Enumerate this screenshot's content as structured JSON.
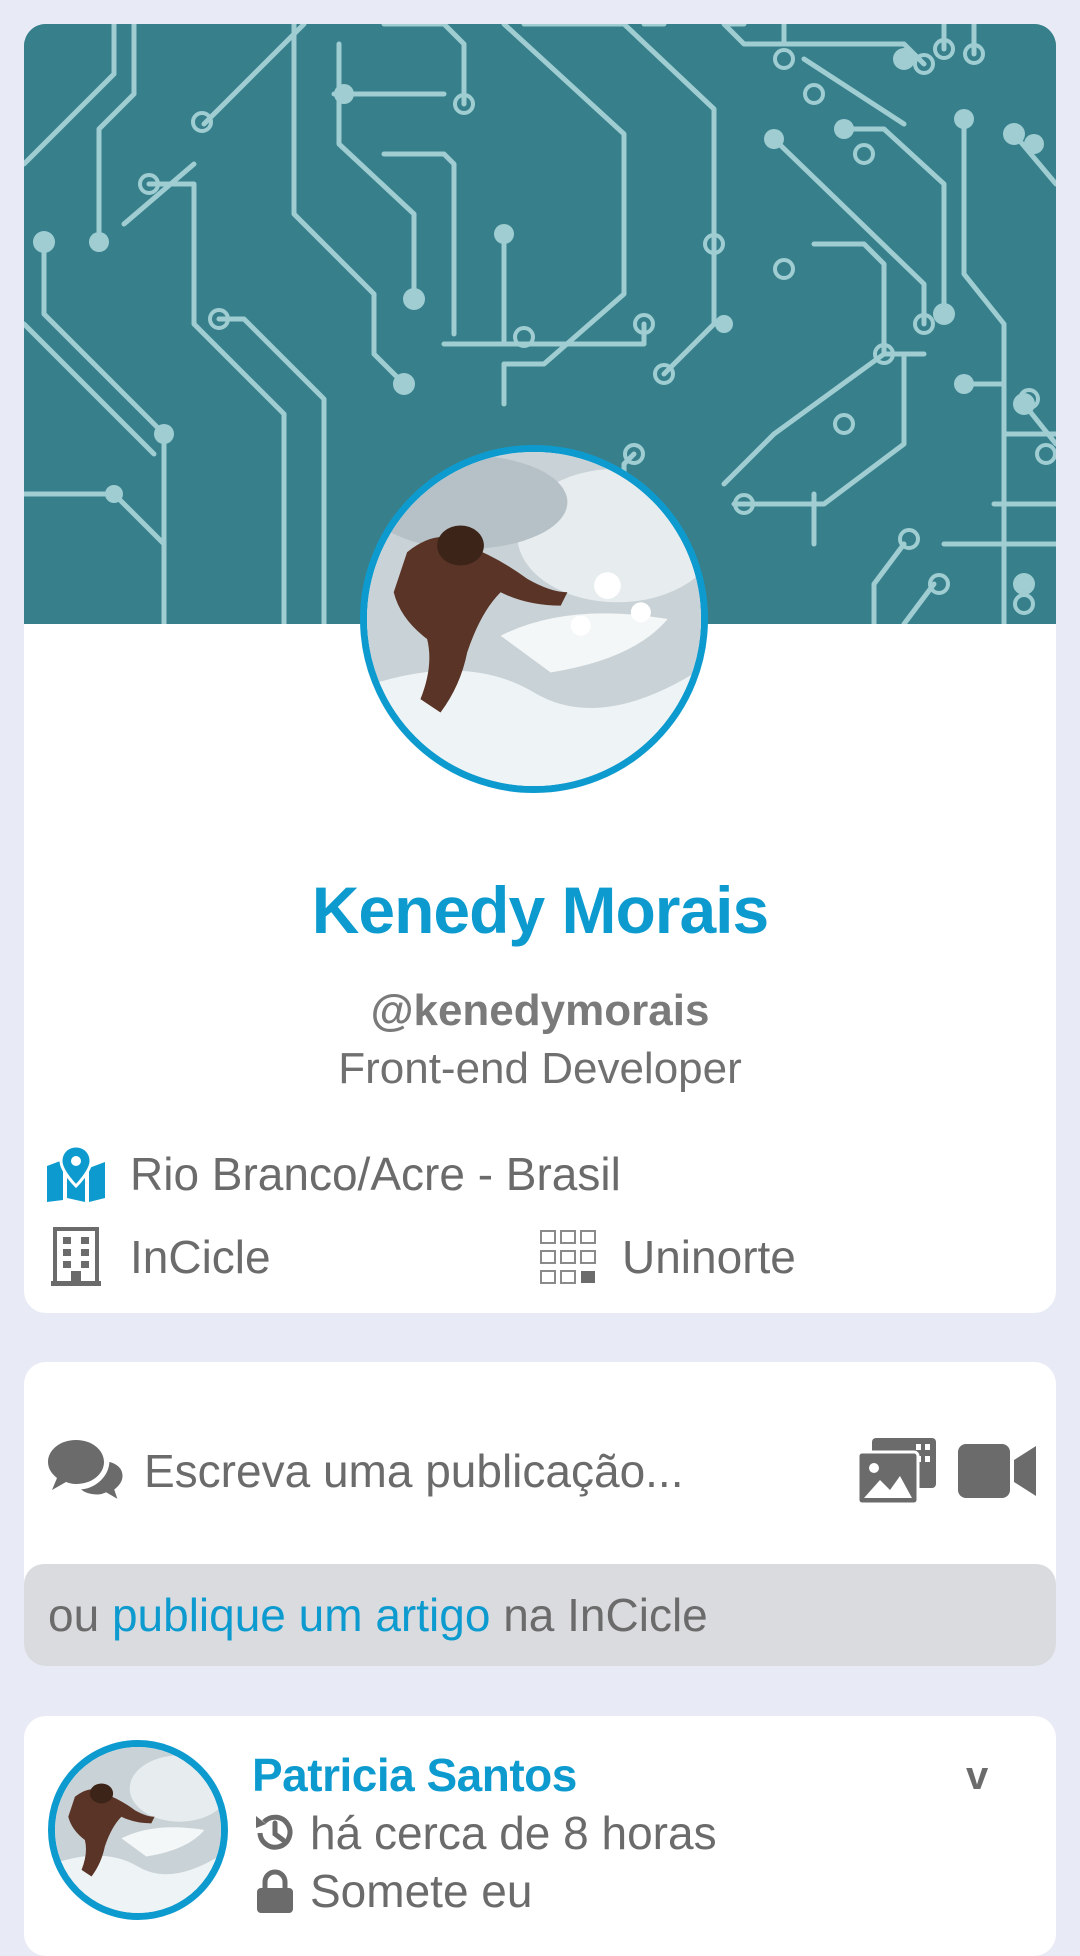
{
  "profile": {
    "name": "Kenedy Morais",
    "handle": "@kenedymorais",
    "role": "Front-end Developer",
    "location": "Rio Branco/Acre - Brasil",
    "company": "InCicle",
    "school": "Uninorte",
    "location_icon": "map-pin-icon",
    "company_icon": "building-icon",
    "school_icon": "grid-icon"
  },
  "composer": {
    "placeholder": "Escreva uma publicação...",
    "icons": [
      "chat-bubbles-icon",
      "photo-gallery-icon",
      "video-camera-icon"
    ],
    "article_prefix": "ou ",
    "article_link": "publique um artigo",
    "article_suffix": " na InCicle"
  },
  "post": {
    "author": "Patricia Santos",
    "time": "há cerca de 8 horas",
    "privacy": "Somete eu",
    "menu_label": "v"
  },
  "colors": {
    "accent": "#0d9bcf",
    "cover": "#37808b",
    "background": "#e8eaf6",
    "text_muted": "#6b6b6b"
  }
}
